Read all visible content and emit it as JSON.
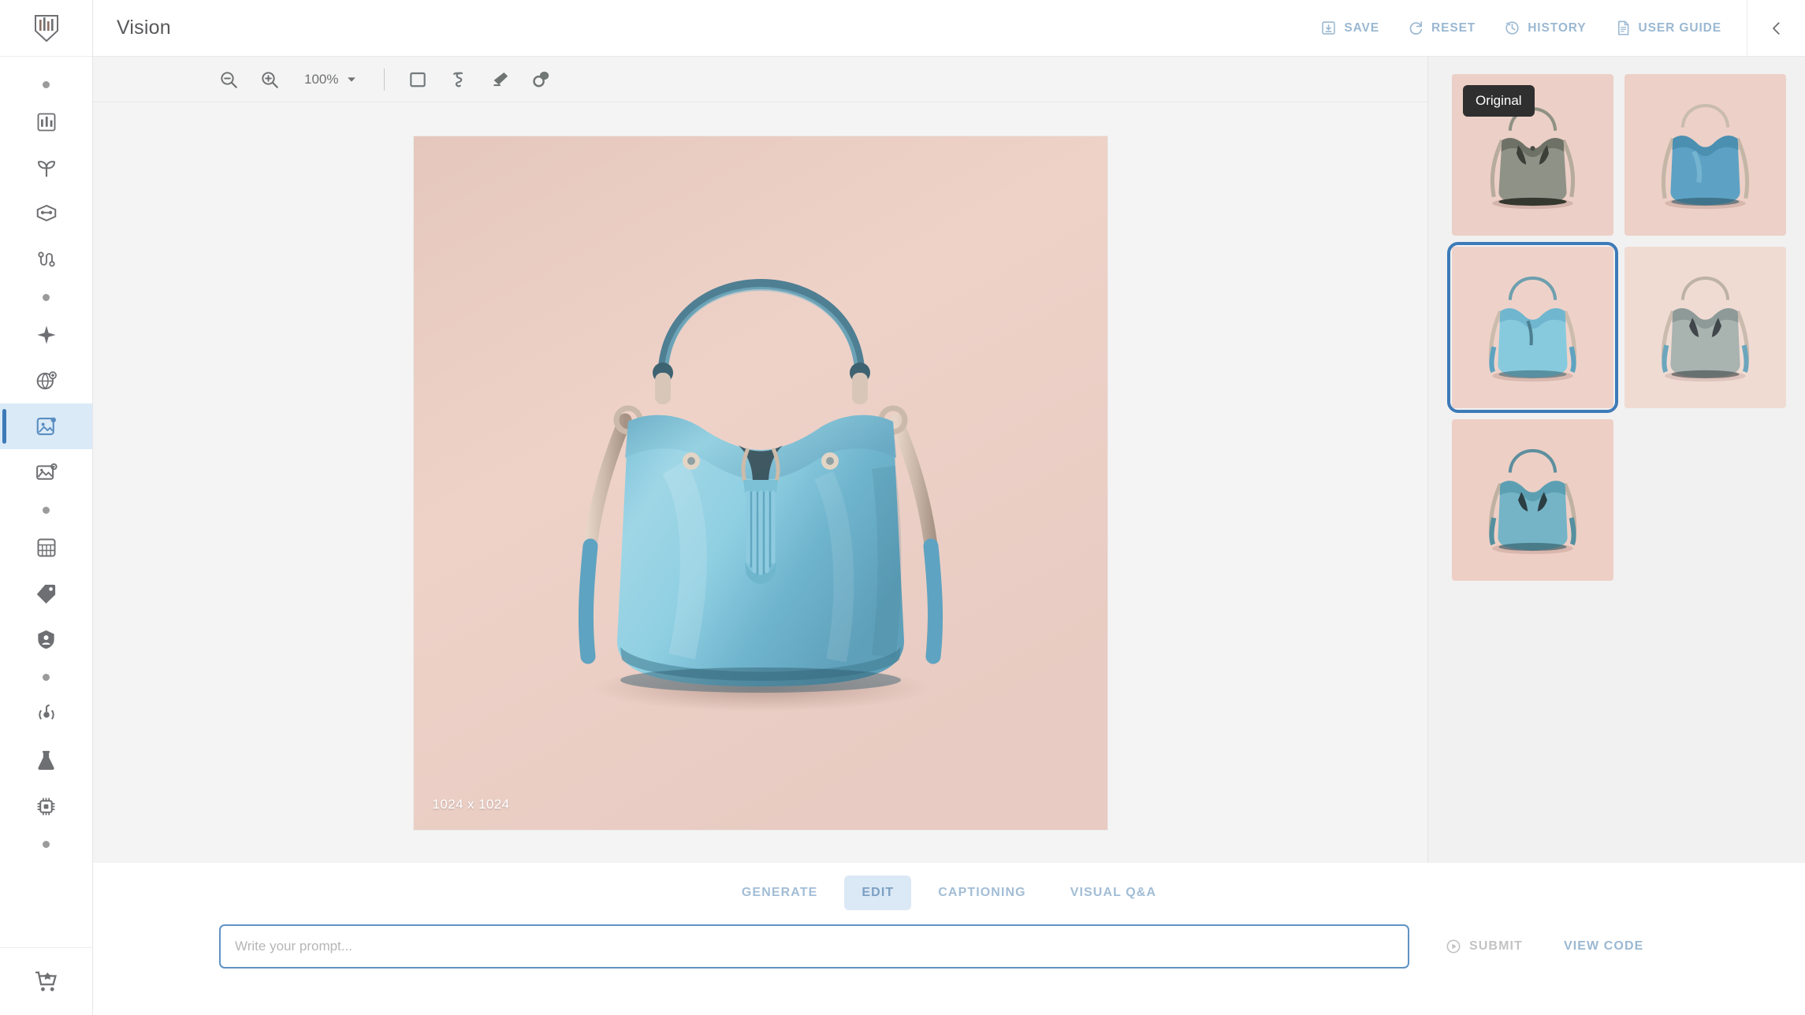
{
  "header": {
    "title": "Vision",
    "actions": [
      {
        "label": "SAVE",
        "icon": "save-icon"
      },
      {
        "label": "RESET",
        "icon": "reset-icon"
      },
      {
        "label": "HISTORY",
        "icon": "history-icon"
      },
      {
        "label": "USER GUIDE",
        "icon": "document-icon"
      }
    ],
    "collapse_icon": "chevron-left-icon"
  },
  "sidebar": {
    "logo_icon": "logo-icon",
    "items": [
      {
        "icon": "dot-icon",
        "label": ""
      },
      {
        "icon": "dashboard-icon",
        "label": ""
      },
      {
        "icon": "sprout-icon",
        "label": ""
      },
      {
        "icon": "model-icon",
        "label": ""
      },
      {
        "icon": "pipeline-icon",
        "label": ""
      },
      {
        "icon": "dot-icon",
        "label": ""
      },
      {
        "icon": "sparkle-icon",
        "label": ""
      },
      {
        "icon": "globe-plus-icon",
        "label": ""
      },
      {
        "icon": "vision-image-icon",
        "label": "",
        "selected": true
      },
      {
        "icon": "image-analysis-icon",
        "label": ""
      },
      {
        "icon": "dot-icon",
        "label": ""
      },
      {
        "icon": "table-icon",
        "label": ""
      },
      {
        "icon": "tag-icon",
        "label": ""
      },
      {
        "icon": "shield-user-icon",
        "label": ""
      },
      {
        "icon": "dot-icon",
        "label": ""
      },
      {
        "icon": "broadcast-icon",
        "label": ""
      },
      {
        "icon": "flask-icon",
        "label": ""
      },
      {
        "icon": "chip-icon",
        "label": ""
      },
      {
        "icon": "dot-icon",
        "label": ""
      }
    ],
    "footer_item": {
      "icon": "cart-icon",
      "label": ""
    }
  },
  "toolbar": {
    "zoom_out_icon": "zoom-out-icon",
    "zoom_in_icon": "zoom-in-icon",
    "zoom_level": "100%",
    "zoom_dropdown_icon": "chevron-down-icon",
    "tools": [
      {
        "icon": "rectangle-select-icon",
        "name": "rectangle-select"
      },
      {
        "icon": "lasso-icon",
        "name": "lasso"
      },
      {
        "icon": "eraser-icon",
        "name": "eraser"
      },
      {
        "icon": "smudge-icon",
        "name": "smudge"
      }
    ]
  },
  "canvas": {
    "dimensions_label": "1024 x 1024",
    "image_alt": "light blue leather bucket handbag with tassel on pink background"
  },
  "thumbnails": {
    "original_badge": "Original",
    "items": [
      {
        "name": "thumbnail-original",
        "variant": "grey-green",
        "selected": false,
        "badge": "Original"
      },
      {
        "name": "thumbnail-variant-1",
        "variant": "blue-smooth",
        "selected": false
      },
      {
        "name": "thumbnail-variant-2",
        "variant": "light-blue",
        "selected": true
      },
      {
        "name": "thumbnail-variant-3",
        "variant": "silver",
        "selected": false
      },
      {
        "name": "thumbnail-variant-4",
        "variant": "teal",
        "selected": false
      }
    ]
  },
  "modes": {
    "tabs": [
      {
        "label": "GENERATE",
        "active": false
      },
      {
        "label": "EDIT",
        "active": true
      },
      {
        "label": "CAPTIONING",
        "active": false
      },
      {
        "label": "VISUAL Q&A",
        "active": false
      }
    ]
  },
  "prompt": {
    "value": "",
    "placeholder": "Write your prompt...",
    "submit_label": "SUBMIT",
    "submit_icon": "play-circle-icon",
    "view_code_label": "VIEW CODE"
  },
  "colors": {
    "accent": "#3d7ab8",
    "header_action": "#9bb8d2",
    "tab_active_bg": "#dbe8f5",
    "canvas_bg": "#f4f4f4",
    "panel_bg": "#f1f1f1",
    "badge_bg": "#2f2f2f"
  }
}
